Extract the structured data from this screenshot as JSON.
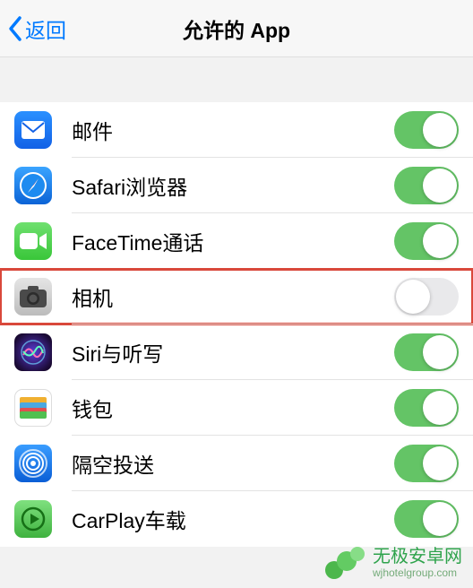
{
  "nav": {
    "back": "返回",
    "title": "允许的 App"
  },
  "apps": [
    {
      "id": "mail",
      "label": "邮件",
      "on": true,
      "hl": false
    },
    {
      "id": "safari",
      "label": "Safari浏览器",
      "on": true,
      "hl": false
    },
    {
      "id": "facetime",
      "label": "FaceTime通话",
      "on": true,
      "hl": false
    },
    {
      "id": "camera",
      "label": "相机",
      "on": false,
      "hl": true
    },
    {
      "id": "siri",
      "label": "Siri与听写",
      "on": true,
      "hl": false
    },
    {
      "id": "wallet",
      "label": "钱包",
      "on": true,
      "hl": false
    },
    {
      "id": "airdrop",
      "label": "隔空投送",
      "on": true,
      "hl": false
    },
    {
      "id": "carplay",
      "label": "CarPlay车载",
      "on": true,
      "hl": false
    }
  ],
  "watermark": {
    "line1": "无极安卓网",
    "line2": "wjhotelgroup.com"
  }
}
